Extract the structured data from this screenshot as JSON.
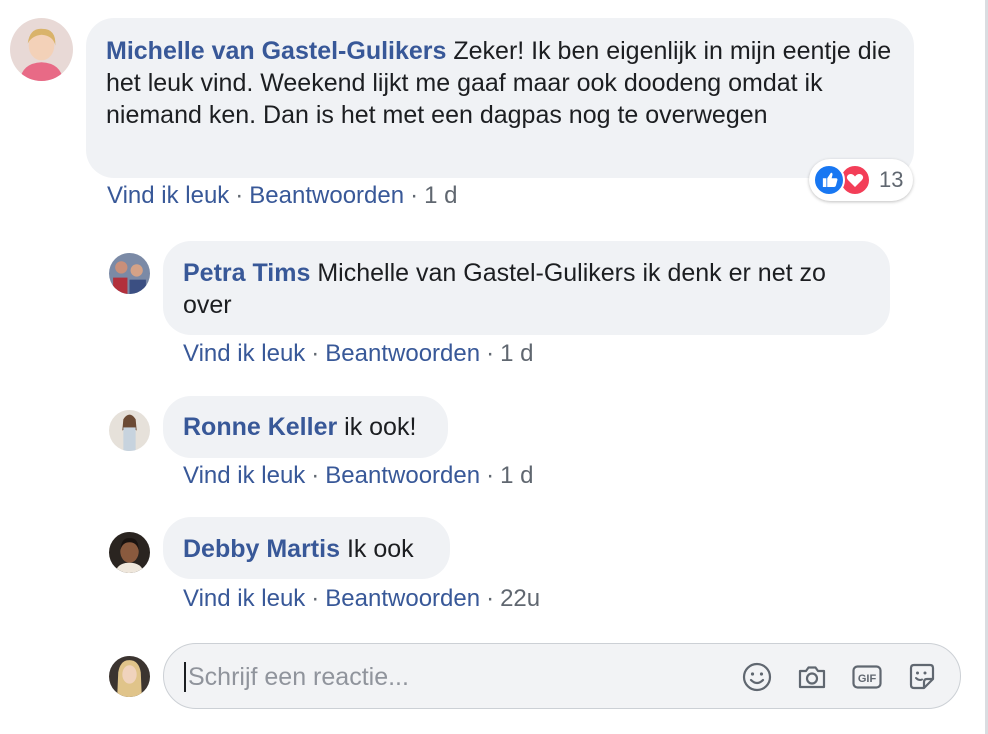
{
  "comments": [
    {
      "author": "Michelle van Gastel-Gulikers",
      "text": "Zeker! Ik ben eigenlijk in mijn eentje die het leuk vind. Weekend lijkt me gaaf maar ook doodeng omdat ik niemand ken. Dan is het met een dagpas nog te overwegen",
      "like_label": "Vind ik leuk",
      "reply_label": "Beantwoorden",
      "time": "1 d",
      "reactions": {
        "types": [
          "like-icon",
          "love-icon"
        ],
        "count": "13"
      }
    }
  ],
  "replies": [
    {
      "author": "Petra Tims",
      "text": "Michelle van Gastel-Gulikers ik denk er net zo over",
      "like_label": "Vind ik leuk",
      "reply_label": "Beantwoorden",
      "time": "1 d"
    },
    {
      "author": "Ronne Keller",
      "text": "ik ook!",
      "like_label": "Vind ik leuk",
      "reply_label": "Beantwoorden",
      "time": "1 d"
    },
    {
      "author": "Debby Martis",
      "text": "Ik ook",
      "like_label": "Vind ik leuk",
      "reply_label": "Beantwoorden",
      "time": "22u"
    }
  ],
  "composer": {
    "placeholder": "Schrijf een reactie...",
    "icons": [
      "emoji-icon",
      "camera-icon",
      "gif-icon",
      "sticker-icon"
    ]
  },
  "colors": {
    "link": "#385898",
    "bubble": "#f0f2f5",
    "like_blue": "#1877f2",
    "love_red": "#f33e58"
  }
}
